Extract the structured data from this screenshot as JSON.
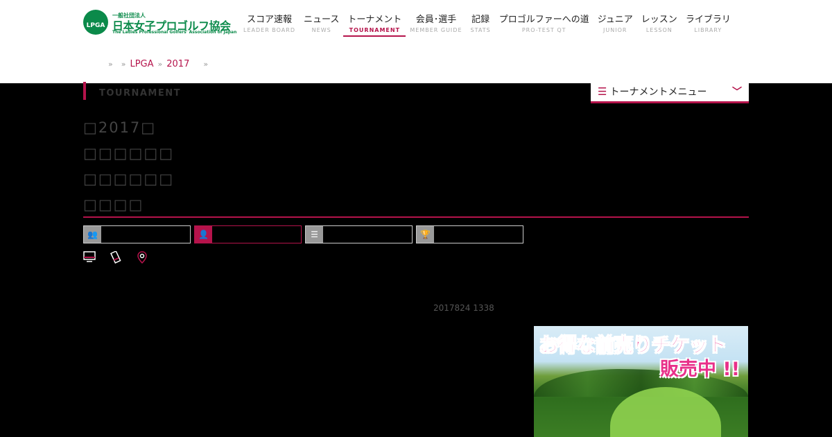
{
  "logo": {
    "mark_text": "LPGA",
    "sub_text": "一般社団法人",
    "main_text": "日本女子プロゴルフ協会",
    "en_text": "The Ladies Professional Golfers' Association of Japan"
  },
  "nav": [
    {
      "jp": "スコア速報",
      "en": "LEADER BOARD"
    },
    {
      "jp": "ニュース",
      "en": "NEWS"
    },
    {
      "jp": "トーナメント",
      "en": "TOURNAMENT"
    },
    {
      "jp": "会員･選手",
      "en": "MEMBER GUIDE"
    },
    {
      "jp": "記録",
      "en": "STATS"
    },
    {
      "jp": "プロゴルファーへの道",
      "en": "PRO-TEST QT"
    },
    {
      "jp": "ジュニア",
      "en": "JUNIOR"
    },
    {
      "jp": "レッスン",
      "en": "LESSON"
    },
    {
      "jp": "ライブラリ",
      "en": "LIBRARY"
    }
  ],
  "breadcrumb": {
    "sep": "»",
    "items": [
      "LPGA",
      "2017"
    ]
  },
  "section_label": "TOURNAMENT",
  "tournament_menu": {
    "label": "トーナメントメニュー",
    "icon": "list-icon",
    "chevron": "chevron-down-icon"
  },
  "title_lines": [
    "2017",
    "",
    "",
    ""
  ],
  "tabs": [
    {
      "icon": "group-icon",
      "label": ""
    },
    {
      "icon": "user-icon",
      "label": ""
    },
    {
      "icon": "list-icon",
      "label": ""
    },
    {
      "icon": "trophy-icon",
      "label": ""
    }
  ],
  "share_icons": [
    "monitor-icon",
    "mobile-icon",
    "map-pin-icon"
  ],
  "updated_text": "2017824 1338",
  "banner": {
    "line1": "お得な前売りチケット",
    "line2": "販売中 !!"
  },
  "colors": {
    "accent": "#b5134b",
    "logo_green": "#0b8a4a",
    "banner_text": "#e8308a"
  }
}
